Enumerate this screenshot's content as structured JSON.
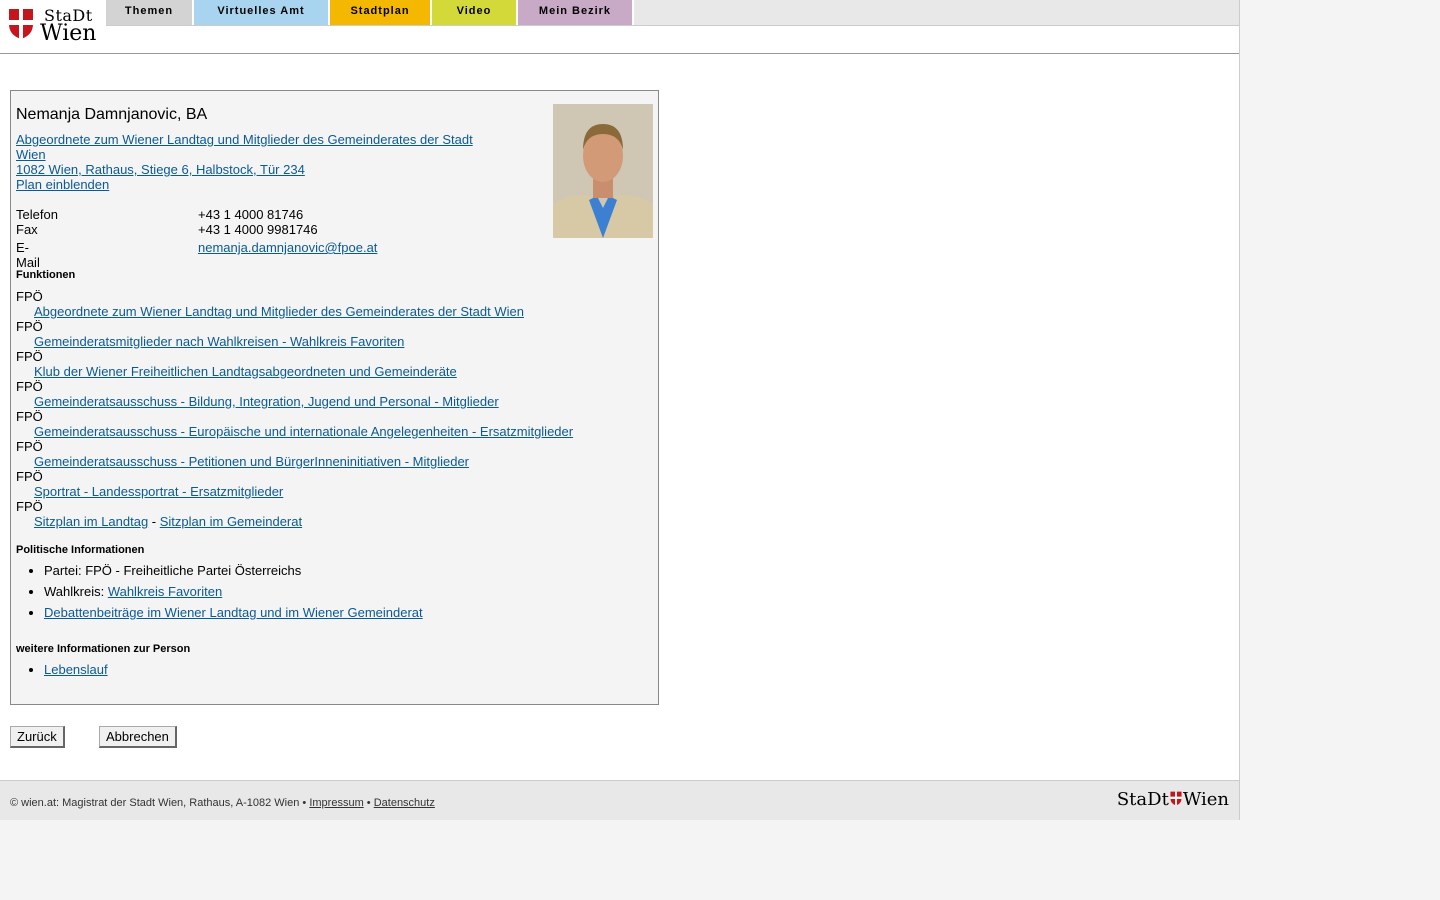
{
  "logo": {
    "line1": "StaDt",
    "line2": "Wien"
  },
  "nav": [
    {
      "label": "Themen",
      "color": "#d3d3d3"
    },
    {
      "label": "Virtuelles Amt",
      "color": "#a9d4ef"
    },
    {
      "label": "Stadtplan",
      "color": "#f5b800"
    },
    {
      "label": "Video",
      "color": "#d4d93a"
    },
    {
      "label": "Mein Bezirk",
      "color": "#c8a9c6"
    }
  ],
  "person": {
    "name": "Nemanja Damnjanovic, BA",
    "role_line1": "Abgeordnete zum Wiener Landtag und Mitglieder des Gemeinderates der Stadt",
    "role_line2": "Wien",
    "address": "1082 Wien, Rathaus, Stiege 6, Halbstock, Tür 234",
    "plan_link": "Plan einblenden",
    "phone_label": "Telefon",
    "phone": "+43 1 4000 81746",
    "fax_label": "Fax",
    "fax": "+43 1 4000 9981746",
    "email_label": "E-Mail",
    "email": "nemanja.damnjanovic@fpoe.at"
  },
  "functions_heading": "Funktionen",
  "functions": [
    {
      "party": "FPÖ",
      "link": "Abgeordnete zum Wiener Landtag und Mitglieder des Gemeinderates der Stadt Wien"
    },
    {
      "party": "FPÖ",
      "link": "Gemeinderatsmitglieder nach Wahlkreisen - Wahlkreis Favoriten"
    },
    {
      "party": "FPÖ",
      "link": "Klub der Wiener Freiheitlichen Landtagsabgeordneten und Gemeinderäte"
    },
    {
      "party": "FPÖ",
      "link": "Gemeinderatsausschuss - Bildung, Integration, Jugend und Personal - Mitglieder"
    },
    {
      "party": "FPÖ",
      "link": "Gemeinderatsausschuss - Europäische und internationale Angelegenheiten - Ersatzmitglieder"
    },
    {
      "party": "FPÖ",
      "link": "Gemeinderatsausschuss - Petitionen und BürgerInneninitiativen - Mitglieder"
    },
    {
      "party": "FPÖ",
      "link": "Sportrat - Landessportrat - Ersatzmitglieder"
    }
  ],
  "seating": {
    "party": "FPÖ",
    "landtag": "Sitzplan im Landtag",
    "sep": " - ",
    "gemeinderat": "Sitzplan im Gemeinderat"
  },
  "political_heading": "Politische Informationen",
  "political": {
    "party_label": "Partei: ",
    "party_value": "FPÖ - Freiheitliche Partei Österreichs",
    "district_label": "Wahlkreis: ",
    "district_link": "Wahlkreis Favoriten",
    "debates_link": "Debattenbeiträge im Wiener Landtag und im Wiener Gemeinderat"
  },
  "more_heading": "weitere Informationen zur Person",
  "more": {
    "cv_link": "Lebenslauf"
  },
  "buttons": {
    "back": "Zurück",
    "cancel": "Abbrechen"
  },
  "footer": {
    "copyright": "© wien.at: Magistrat der Stadt Wien, Rathaus, A-1082 Wien • ",
    "impressum": "Impressum",
    "sep": " • ",
    "privacy": "Datenschutz",
    "logo_left": "StaDt",
    "logo_right": "Wien"
  }
}
